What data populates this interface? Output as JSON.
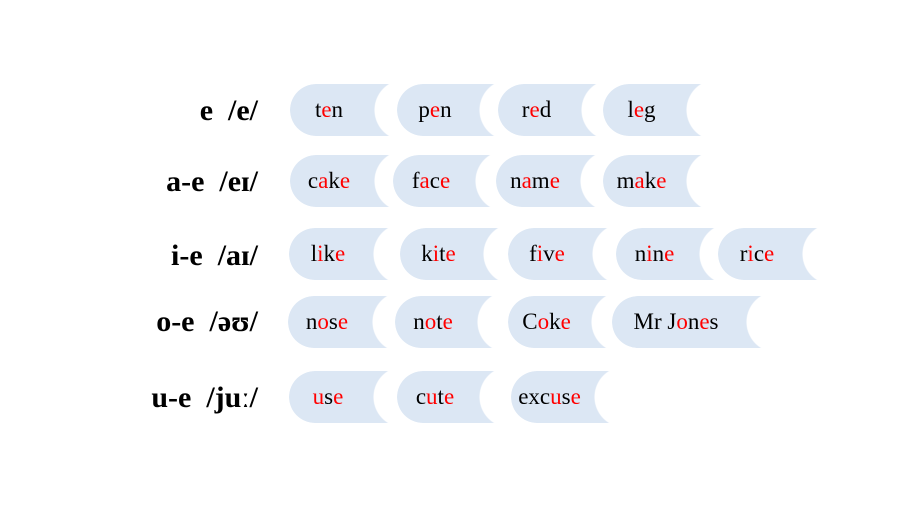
{
  "colors": {
    "chip": "#dce7f4",
    "highlight": "#ff0000",
    "text": "#000000"
  },
  "rows": [
    {
      "label": "e  /e/",
      "words": [
        [
          [
            "t",
            0
          ],
          [
            "e",
            1
          ],
          [
            "n",
            0
          ]
        ],
        [
          [
            "p",
            0
          ],
          [
            "e",
            1
          ],
          [
            "n",
            0
          ]
        ],
        [
          [
            "r",
            0
          ],
          [
            "e",
            1
          ],
          [
            "d",
            0
          ]
        ],
        [
          [
            "l",
            0
          ],
          [
            "e",
            1
          ],
          [
            "g",
            0
          ]
        ]
      ]
    },
    {
      "label": "a-e  /eɪ/",
      "words": [
        [
          [
            "c",
            0
          ],
          [
            "a",
            1
          ],
          [
            "k",
            0
          ],
          [
            "e",
            1
          ]
        ],
        [
          [
            "f",
            0
          ],
          [
            "a",
            1
          ],
          [
            "c",
            0
          ],
          [
            "e",
            1
          ]
        ],
        [
          [
            "n",
            0
          ],
          [
            "a",
            1
          ],
          [
            "m",
            0
          ],
          [
            "e",
            1
          ]
        ],
        [
          [
            "m",
            0
          ],
          [
            "a",
            1
          ],
          [
            "k",
            0
          ],
          [
            "e",
            1
          ]
        ]
      ]
    },
    {
      "label": "i-e  /aɪ/",
      "words": [
        [
          [
            "l",
            0
          ],
          [
            "i",
            1
          ],
          [
            "k",
            0
          ],
          [
            "e",
            1
          ]
        ],
        [
          [
            "k",
            0
          ],
          [
            "i",
            1
          ],
          [
            "t",
            0
          ],
          [
            "e",
            1
          ]
        ],
        [
          [
            "f",
            0
          ],
          [
            "i",
            1
          ],
          [
            "v",
            0
          ],
          [
            "e",
            1
          ]
        ],
        [
          [
            "n",
            0
          ],
          [
            "i",
            1
          ],
          [
            "n",
            0
          ],
          [
            "e",
            1
          ]
        ],
        [
          [
            "r",
            0
          ],
          [
            "i",
            1
          ],
          [
            "c",
            0
          ],
          [
            "e",
            1
          ]
        ]
      ]
    },
    {
      "label": "o-e  /əʊ/",
      "words": [
        [
          [
            "n",
            0
          ],
          [
            "o",
            1
          ],
          [
            "s",
            0
          ],
          [
            "e",
            1
          ]
        ],
        [
          [
            "n",
            0
          ],
          [
            "o",
            1
          ],
          [
            "t",
            0
          ],
          [
            "e",
            1
          ]
        ],
        [
          [
            "C",
            0
          ],
          [
            "o",
            1
          ],
          [
            "k",
            0
          ],
          [
            "e",
            1
          ]
        ],
        [
          [
            "Mr J",
            0
          ],
          [
            "o",
            1
          ],
          [
            "n",
            0
          ],
          [
            "e",
            1
          ],
          [
            "s",
            0
          ]
        ]
      ]
    },
    {
      "label": "u-e  /juː/",
      "words": [
        [
          [
            "u",
            1
          ],
          [
            "s",
            0
          ],
          [
            "e",
            1
          ]
        ],
        [
          [
            "c",
            0
          ],
          [
            "u",
            1
          ],
          [
            "t",
            0
          ],
          [
            "e",
            1
          ]
        ],
        [
          [
            "exc",
            0
          ],
          [
            "u",
            1
          ],
          [
            "s",
            0
          ],
          [
            "e",
            1
          ]
        ]
      ]
    }
  ]
}
